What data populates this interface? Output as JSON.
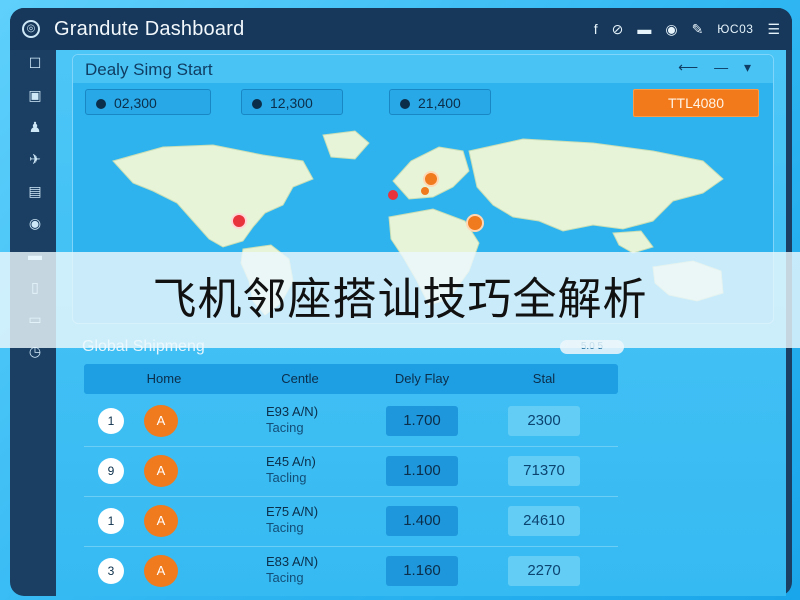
{
  "app": {
    "title": "Grandute Dashboard"
  },
  "topbar": {
    "icons": [
      "f",
      "⊘",
      "▬",
      "◉",
      "✎"
    ],
    "code": "ЮC03"
  },
  "sidebar": {
    "icons": [
      "☐",
      "▣",
      "♟",
      "✈",
      "▤",
      "◉",
      "▬",
      "▯",
      "▭",
      "◷"
    ]
  },
  "panel": {
    "title": "Dealy Simg Start",
    "controls": "⟵ — ▾",
    "stats": [
      {
        "label": "02,300"
      },
      {
        "label": "12,300"
      },
      {
        "label": "21,400"
      }
    ],
    "action": "TTL4080"
  },
  "overlay": {
    "text": "飞机邻座搭讪技巧全解析"
  },
  "shipments": {
    "title": "Global Shipmeng",
    "pill": "5.0 5",
    "headers": [
      "Home",
      "Centle",
      "Dely Flay",
      "Stal"
    ],
    "rows": [
      {
        "num": "1",
        "badge": "A",
        "line1": "E93 A/N)",
        "line2": "Tacing",
        "a": "1.700",
        "b": "2300"
      },
      {
        "num": "9",
        "badge": "A",
        "line1": "E45 A/n)",
        "line2": "Tacling",
        "a": "1.100",
        "b": "71370"
      },
      {
        "num": "1",
        "badge": "A",
        "line1": "E75 A/N)",
        "line2": "Tacing",
        "a": "1.400",
        "b": "24610"
      },
      {
        "num": "3",
        "badge": "A",
        "line1": "E83 A/N)",
        "line2": "Tacing",
        "a": "1.160",
        "b": "2270"
      }
    ]
  },
  "colors": {
    "accent": "#f27a1a",
    "frame": "#1b3f63",
    "panel": "#2fb3ee",
    "marker_red": "#e8323c",
    "marker_orange": "#f07a1e"
  }
}
